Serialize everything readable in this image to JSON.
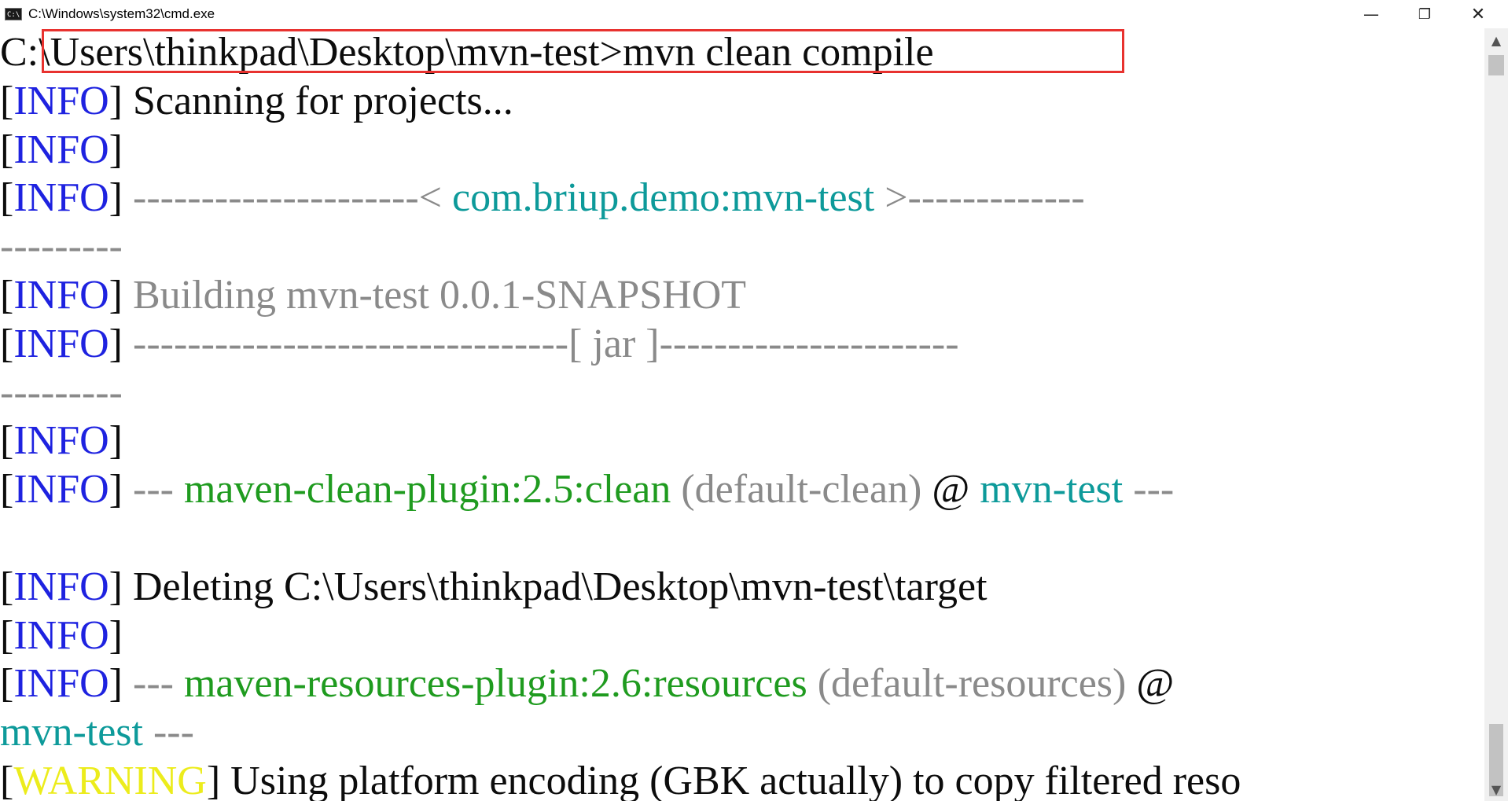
{
  "window": {
    "title": "C:\\Windows\\system32\\cmd.exe",
    "icon_label": "C:\\",
    "minimize_glyph": "—",
    "maximize_glyph": "❐",
    "close_glyph": "✕"
  },
  "lines": [
    [
      {
        "t": "C:",
        "c": "blk"
      },
      {
        "t": "\\Users\\thinkpad\\Desktop\\mvn-test>mvn clean compile",
        "c": "blk"
      }
    ],
    [
      {
        "t": "[",
        "c": "blk"
      },
      {
        "t": "INFO",
        "c": "blue"
      },
      {
        "t": "] Scanning for projects...",
        "c": "blk"
      }
    ],
    [
      {
        "t": "[",
        "c": "blk"
      },
      {
        "t": "INFO",
        "c": "blue"
      },
      {
        "t": "]",
        "c": "blk"
      }
    ],
    [
      {
        "t": "[",
        "c": "blk"
      },
      {
        "t": "INFO",
        "c": "blue"
      },
      {
        "t": "] ",
        "c": "blk"
      },
      {
        "t": "---------------------< ",
        "c": "gray"
      },
      {
        "t": "com.briup.demo:mvn-test",
        "c": "cyan"
      },
      {
        "t": " >-------------",
        "c": "gray"
      }
    ],
    [
      {
        "t": "---------",
        "c": "gray"
      }
    ],
    [
      {
        "t": "[",
        "c": "blk"
      },
      {
        "t": "INFO",
        "c": "blue"
      },
      {
        "t": "] ",
        "c": "blk"
      },
      {
        "t": "Building mvn-test 0.0.1-SNAPSHOT",
        "c": "gray"
      }
    ],
    [
      {
        "t": "[",
        "c": "blk"
      },
      {
        "t": "INFO",
        "c": "blue"
      },
      {
        "t": "] ",
        "c": "blk"
      },
      {
        "t": "--------------------------------[ jar ]----------------------",
        "c": "gray"
      }
    ],
    [
      {
        "t": "---------",
        "c": "gray"
      }
    ],
    [
      {
        "t": "[",
        "c": "blk"
      },
      {
        "t": "INFO",
        "c": "blue"
      },
      {
        "t": "]",
        "c": "blk"
      }
    ],
    [
      {
        "t": "[",
        "c": "blk"
      },
      {
        "t": "INFO",
        "c": "blue"
      },
      {
        "t": "] ",
        "c": "blk"
      },
      {
        "t": "--- ",
        "c": "gray"
      },
      {
        "t": "maven-clean-plugin:2.5:clean",
        "c": "green"
      },
      {
        "t": " (default-clean)",
        "c": "gray"
      },
      {
        "t": " @ ",
        "c": "blk"
      },
      {
        "t": "mvn-test",
        "c": "cyan"
      },
      {
        "t": " ---",
        "c": "gray"
      }
    ],
    [
      {
        "t": "",
        "c": "blk"
      }
    ],
    [
      {
        "t": "[",
        "c": "blk"
      },
      {
        "t": "INFO",
        "c": "blue"
      },
      {
        "t": "] Deleting C:\\Users\\thinkpad\\Desktop\\mvn-test\\target",
        "c": "blk"
      }
    ],
    [
      {
        "t": "[",
        "c": "blk"
      },
      {
        "t": "INFO",
        "c": "blue"
      },
      {
        "t": "]",
        "c": "blk"
      }
    ],
    [
      {
        "t": "[",
        "c": "blk"
      },
      {
        "t": "INFO",
        "c": "blue"
      },
      {
        "t": "] ",
        "c": "blk"
      },
      {
        "t": "--- ",
        "c": "gray"
      },
      {
        "t": "maven-resources-plugin:2.6:resources",
        "c": "green"
      },
      {
        "t": " (default-resources)",
        "c": "gray"
      },
      {
        "t": " @",
        "c": "blk"
      }
    ],
    [
      {
        "t": "mvn-test",
        "c": "cyan"
      },
      {
        "t": " ---",
        "c": "gray"
      }
    ],
    [
      {
        "t": "[",
        "c": "blk"
      },
      {
        "t": "WARNING",
        "c": "yellow"
      },
      {
        "t": "] Using platform encoding (GBK actually) to copy filtered reso",
        "c": "blk"
      }
    ]
  ],
  "scrollbar": {
    "up_glyph": "▲",
    "down_glyph": "▼"
  }
}
